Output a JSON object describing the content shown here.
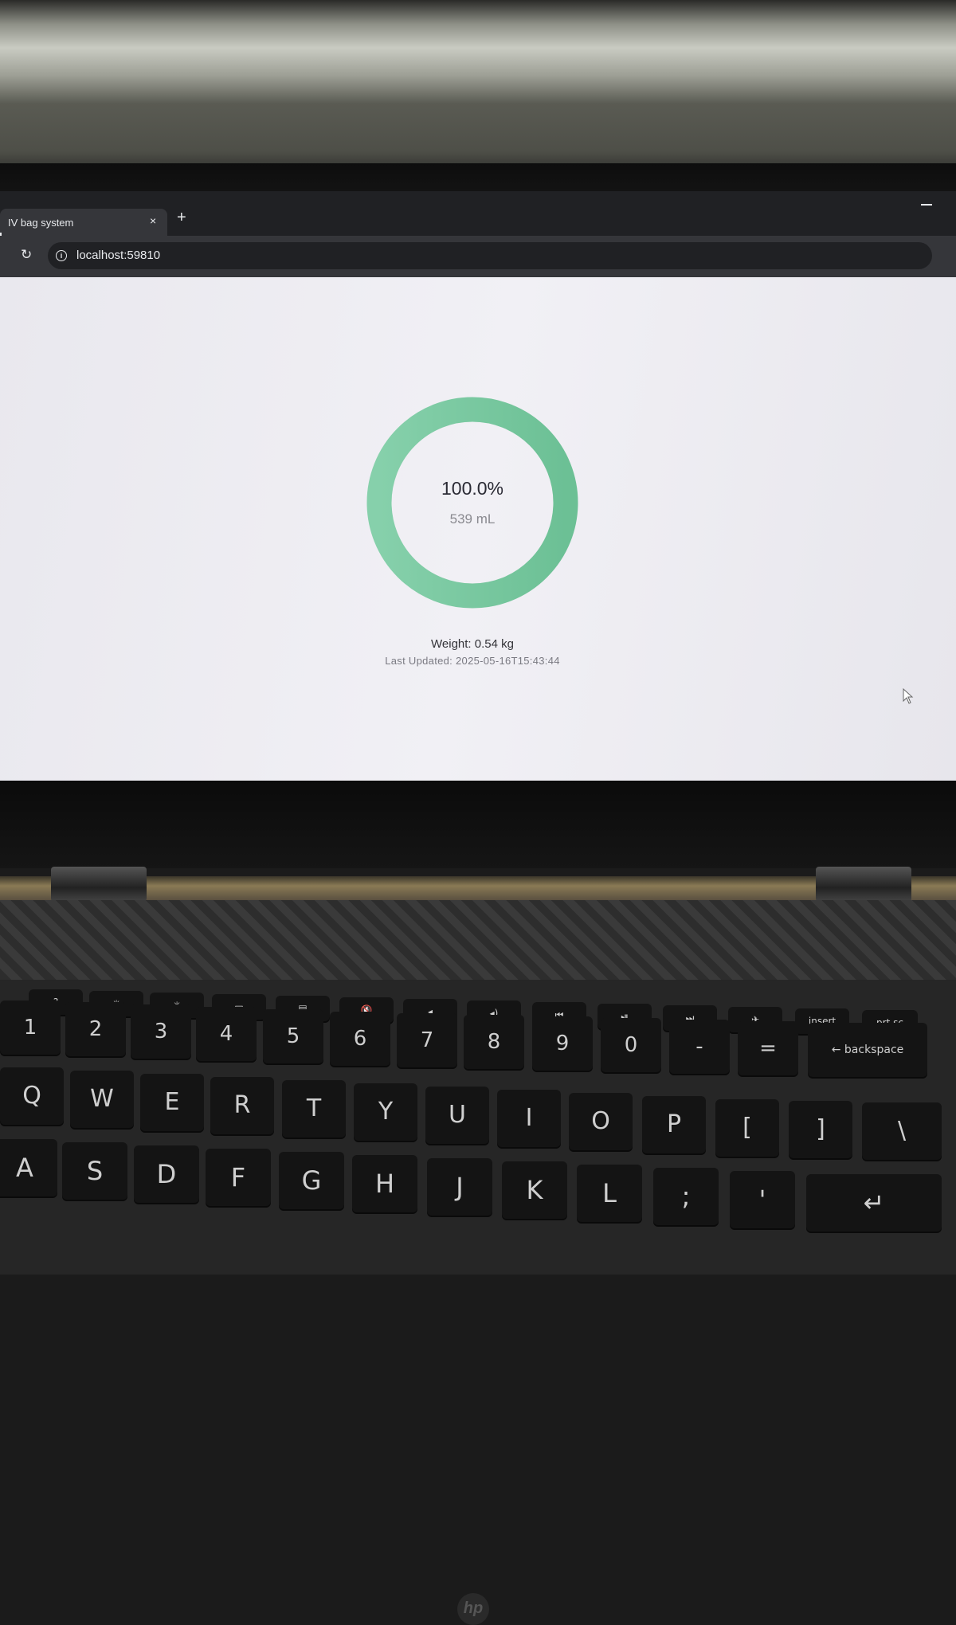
{
  "browser": {
    "tab_title": "IV bag system",
    "tab_close": "×",
    "new_tab": "+",
    "reload": "↻",
    "url": "localhost:59810",
    "info_icon": "i",
    "bookmark_star": "☆"
  },
  "dashboard": {
    "fill_percent": 100.0,
    "percent_label": "100.0%",
    "volume_label": "539 mL",
    "weight_label": "Weight: 0.54 kg",
    "last_updated_label": "Last Updated: 2025-05-16T15:43:44",
    "gauge_color": "#6cc095",
    "gauge_color_light": "#86d0ab"
  },
  "laptop": {
    "brand": "hp",
    "function_keys": [
      "?",
      "✳",
      "✳",
      "▭",
      "▤",
      "🔇",
      "◂",
      "◂)",
      "⏮",
      "⏯",
      "⏭",
      "✈",
      "insert",
      "prt sc"
    ],
    "number_keys": [
      "1",
      "2",
      "3",
      "4",
      "5",
      "6",
      "7",
      "8",
      "9",
      "0",
      "-",
      "=",
      "← backspace"
    ],
    "qwerty_keys": [
      "Q",
      "W",
      "E",
      "R",
      "T",
      "Y",
      "U",
      "I",
      "O",
      "P",
      "[",
      "]",
      "\\"
    ],
    "asdf_keys": [
      "A",
      "S",
      "D",
      "F",
      "G",
      "H",
      "J",
      "K",
      "L",
      ";",
      "'",
      "↵"
    ]
  }
}
